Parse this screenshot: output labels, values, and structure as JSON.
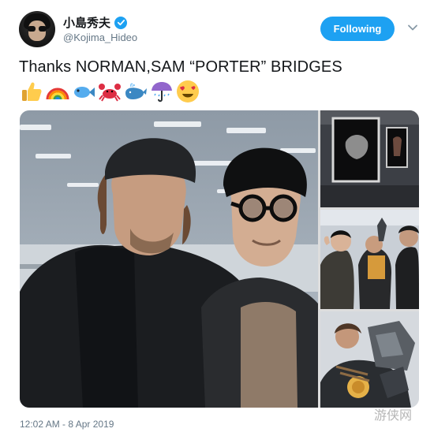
{
  "user": {
    "display_name": "小島秀夫",
    "handle": "@Kojima_Hideo",
    "verified": true
  },
  "follow_button": {
    "label": "Following"
  },
  "tweet": {
    "text": "Thanks NORMAN,SAM  “PORTER” BRIDGES",
    "emojis": [
      "thumbs-up-icon",
      "rainbow-icon",
      "fish-icon",
      "crab-icon",
      "whale-icon",
      "umbrella-icon",
      "heart-eyes-icon"
    ]
  },
  "media": {
    "count": 4,
    "items": [
      "photo-two-men-office",
      "photo-framed-artwork-wall",
      "photo-group-with-figure",
      "photo-porter-figure-closeup"
    ]
  },
  "timestamp": "12:02 AM - 8 Apr 2019",
  "watermark": "游侠网",
  "colors": {
    "accent": "#1da1f2",
    "text": "#14171a",
    "secondary_text": "#657786"
  }
}
